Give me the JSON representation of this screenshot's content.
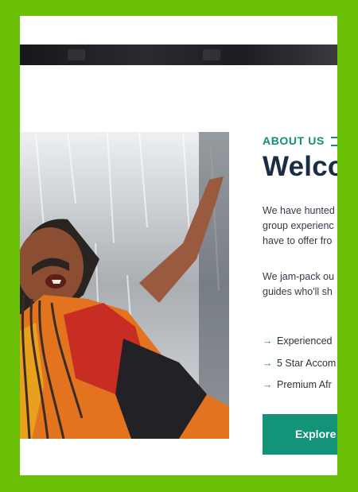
{
  "about": {
    "eyebrow": "ABOUT US",
    "heading": "Welco",
    "paragraph1": [
      "We have hunted",
      "group experienc",
      "have to offer fro"
    ],
    "paragraph2": [
      "We jam-pack ou",
      "guides who'll sh"
    ],
    "features": [
      {
        "icon": "arrow-right-icon",
        "label": "Experienced"
      },
      {
        "icon": "arrow-right-icon",
        "label": "5 Star Accom"
      },
      {
        "icon": "arrow-right-icon",
        "label": "Premium Afr"
      }
    ],
    "cta_label": "Explore"
  },
  "colors": {
    "border": "#69c006",
    "accent": "#118f76",
    "heading": "#1b2d45",
    "button": "#139378"
  }
}
